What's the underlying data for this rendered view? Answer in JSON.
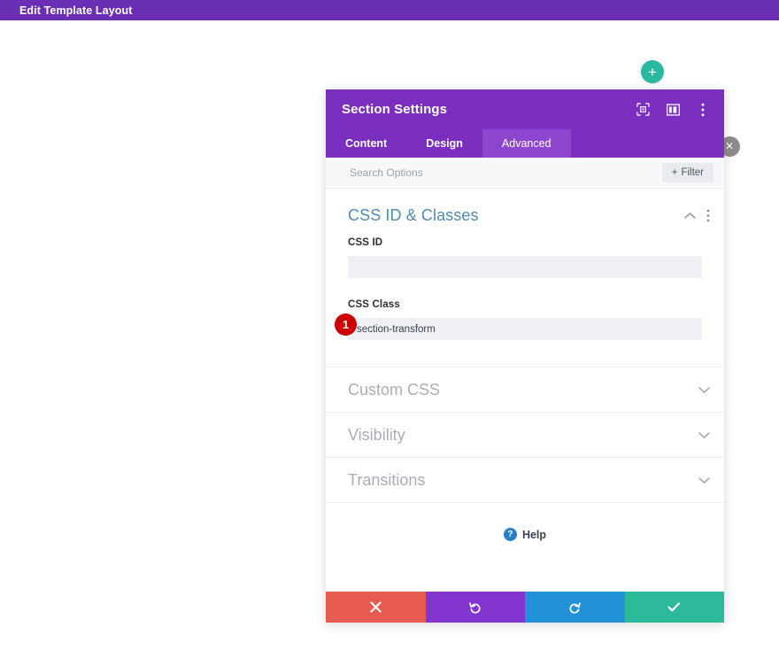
{
  "admin_bar": {
    "title": "Edit Template Layout",
    "bg_color": "#6b2fb5"
  },
  "canvas": {
    "add_button_label": "+",
    "add_button_color": "#29b8a0",
    "close_button_label": "✕"
  },
  "modal": {
    "title": "Section Settings",
    "header_color": "#7b2fbf",
    "header_icons": [
      {
        "name": "focus-icon"
      },
      {
        "name": "layout-columns-icon"
      },
      {
        "name": "more-vertical-icon"
      }
    ],
    "tabs": [
      {
        "label": "Content",
        "active": false
      },
      {
        "label": "Design",
        "active": false
      },
      {
        "label": "Advanced",
        "active": true
      }
    ],
    "search": {
      "placeholder": "Search Options",
      "value": ""
    },
    "filter_button": {
      "plus": "+",
      "label": "Filter"
    },
    "open_section": {
      "title": "CSS ID & Classes",
      "fields": [
        {
          "label": "CSS ID",
          "value": "",
          "placeholder": ""
        },
        {
          "label": "CSS Class",
          "value": "section-transform",
          "placeholder": "",
          "badge": "1",
          "badge_color": "#cc0000"
        }
      ]
    },
    "collapsed_sections": [
      {
        "title": "Custom CSS"
      },
      {
        "title": "Visibility"
      },
      {
        "title": "Transitions"
      }
    ],
    "help": {
      "icon_label": "?",
      "label": "Help"
    },
    "footer_buttons": [
      {
        "name": "cancel-button",
        "icon": "✖",
        "color": "#e85b50"
      },
      {
        "name": "undo-button",
        "icon": "↺",
        "color": "#8236cf"
      },
      {
        "name": "redo-button",
        "icon": "↻",
        "color": "#2291d8"
      },
      {
        "name": "save-button",
        "icon": "✔",
        "color": "#2dba9b"
      }
    ]
  }
}
